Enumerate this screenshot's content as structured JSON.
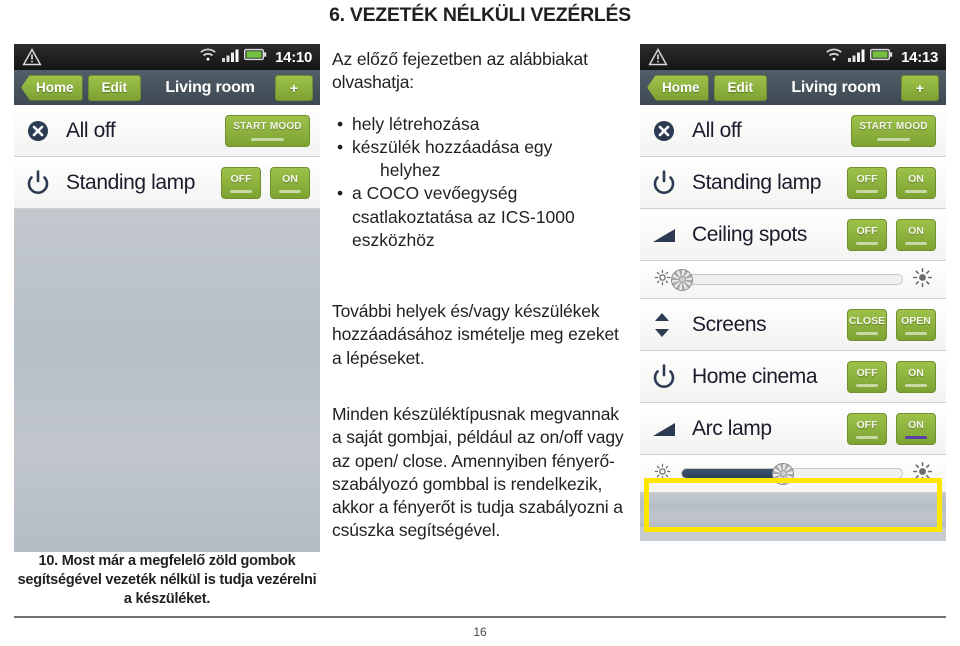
{
  "document": {
    "heading": "6. VEZETÉK NÉLKÜLI VEZÉRLÉS",
    "page_number": "16"
  },
  "center_text": {
    "intro": "Az előző fejezetben az alábbiakat olvashatja:",
    "bullets": [
      "hely létrehozása",
      "készülék hozzáadása egy helyhez",
      "a COCO vevőegység csatlakoztatása az ICS-1000 eszközhöz"
    ],
    "bullet_2_line1": "készülék hozzáadása egy",
    "bullet_2_line2": "helyhez",
    "paragraph_2": "További helyek és/vagy készülékek hozzáadásához ismételje meg ezeket a lépéseket.",
    "paragraph_3": "Minden készüléktípusnak megvannak a saját gombjai, például az on/off vagy az open/ close. Amennyiben fényerő-szabályozó gombbal is rendelkezik, akkor a fényerőt is tudja szabályozni a csúszka segítségével."
  },
  "caption": {
    "text": "10. Most már a megfelelő zöld gombok segítségével vezeték nélkül is tudja vezérelni a készüléket."
  },
  "phone_left": {
    "statusbar": {
      "clock": "14:10"
    },
    "navbar": {
      "home_label": "Home",
      "edit_label": "Edit",
      "title": "Living room",
      "add_label": "+"
    },
    "rows": [
      {
        "icon": "close-circle-icon",
        "label": "All off",
        "buttons": [
          {
            "label": "START MOOD",
            "style": "mood",
            "active": false
          }
        ]
      },
      {
        "icon": "power-icon",
        "label": "Standing lamp",
        "buttons": [
          {
            "label": "OFF",
            "style": "small",
            "active": false
          },
          {
            "label": "ON",
            "style": "small",
            "active": false
          }
        ]
      }
    ]
  },
  "phone_right": {
    "statusbar": {
      "clock": "14:13"
    },
    "navbar": {
      "home_label": "Home",
      "edit_label": "Edit",
      "title": "Living room",
      "add_label": "+"
    },
    "rows": [
      {
        "icon": "close-circle-icon",
        "label": "All off",
        "buttons": [
          {
            "label": "START MOOD",
            "style": "mood",
            "active": false
          }
        ]
      },
      {
        "icon": "power-icon",
        "label": "Standing lamp",
        "buttons": [
          {
            "label": "OFF",
            "style": "small",
            "active": false
          },
          {
            "label": "ON",
            "style": "small",
            "active": false
          }
        ]
      },
      {
        "icon": "dimmer-icon",
        "label": "Ceiling spots",
        "buttons": [
          {
            "label": "OFF",
            "style": "small",
            "active": false
          },
          {
            "label": "ON",
            "style": "small",
            "active": false
          }
        ],
        "slider": {
          "value_percent": 0
        }
      },
      {
        "icon": "updown-arrows-icon",
        "label": "Screens",
        "buttons": [
          {
            "label": "CLOSE",
            "style": "small",
            "active": false
          },
          {
            "label": "OPEN",
            "style": "small",
            "active": false
          }
        ]
      },
      {
        "icon": "power-icon",
        "label": "Home cinema",
        "buttons": [
          {
            "label": "OFF",
            "style": "small",
            "active": false
          },
          {
            "label": "ON",
            "style": "small",
            "active": false
          }
        ]
      },
      {
        "icon": "dimmer-icon",
        "label": "Arc lamp",
        "buttons": [
          {
            "label": "OFF",
            "style": "small",
            "active": false
          },
          {
            "label": "ON",
            "style": "small",
            "active": true
          }
        ],
        "slider": {
          "value_percent": 46
        }
      }
    ]
  },
  "colors": {
    "green_button": "#8cb33f",
    "navbar": "#47525d",
    "highlight": "#ffe600",
    "slider_fill": "#334a66",
    "active_underline": "#5b3fa8",
    "phone_background": "#c6cbd0"
  }
}
